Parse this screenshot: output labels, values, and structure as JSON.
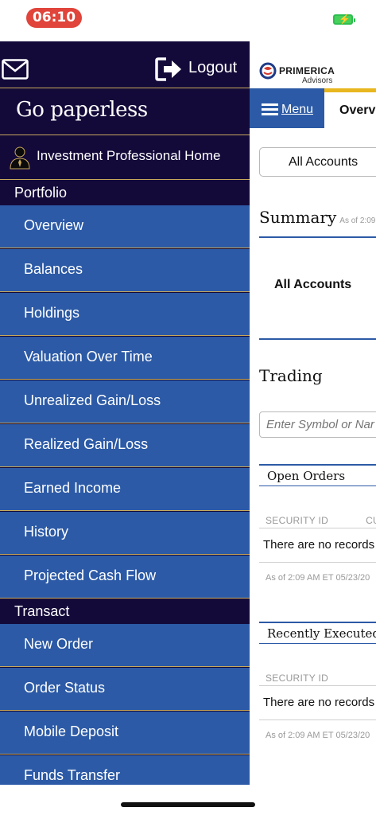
{
  "status_bar": {
    "time": "06:10"
  },
  "drawer": {
    "logout_label": "Logout",
    "paperless_label": "Go paperless",
    "home_label": "Investment Professional Home",
    "sections": [
      {
        "title": "Portfolio",
        "items": [
          "Overview",
          "Balances",
          "Holdings",
          "Valuation Over Time",
          "Unrealized Gain/Loss",
          "Realized Gain/Loss",
          "Earned Income",
          "History",
          "Projected Cash Flow"
        ]
      },
      {
        "title": "Transact",
        "items": [
          "New Order",
          "Order Status",
          "Mobile Deposit",
          "Funds Transfer"
        ]
      }
    ]
  },
  "main": {
    "brand": "PRIMERICA",
    "brand_sub": "Advisors",
    "menu_label": "Menu",
    "tab_label": "Overv",
    "account_selector": "All Accounts",
    "summary_title": "Summary",
    "summary_asof": "As of 2:09",
    "summary_account": "All Accounts",
    "trading_title": "Trading",
    "symbol_placeholder": "Enter Symbol or Nar",
    "open_orders": {
      "title": "Open Orders",
      "col1": "SECURITY ID",
      "col2": "CU",
      "empty": "There are no records",
      "asof": "As of 2:09 AM ET 05/23/20"
    },
    "recently_executed": {
      "title": "Recently Executed",
      "col1": "SECURITY ID",
      "empty": "There are no records",
      "asof": "As of 2:09 AM ET 05/23/20"
    }
  },
  "colors": {
    "drawer_bg": "#140a3a",
    "item_bg": "#2c5aa6",
    "divider": "#c8a85a",
    "accent_gold": "#e8b71f",
    "time_pill": "#e0443a"
  }
}
